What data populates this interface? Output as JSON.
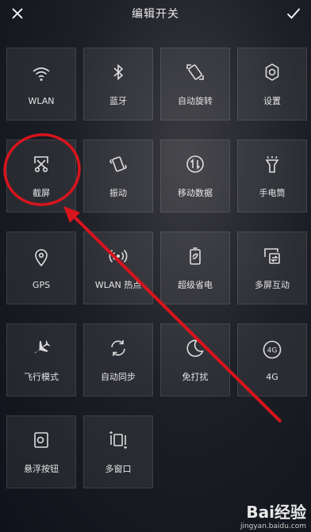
{
  "header": {
    "title": "编辑开关",
    "close_icon": "close-icon",
    "confirm_icon": "check-icon"
  },
  "tiles": [
    {
      "label": "WLAN",
      "icon": "wifi-icon"
    },
    {
      "label": "蓝牙",
      "icon": "bluetooth-icon"
    },
    {
      "label": "自动旋转",
      "icon": "rotate-icon"
    },
    {
      "label": "设置",
      "icon": "gear-icon"
    },
    {
      "label": "截屏",
      "icon": "screenshot-icon"
    },
    {
      "label": "振动",
      "icon": "vibrate-icon"
    },
    {
      "label": "移动数据",
      "icon": "mobile-data-icon"
    },
    {
      "label": "手电筒",
      "icon": "flashlight-icon"
    },
    {
      "label": "GPS",
      "icon": "location-icon"
    },
    {
      "label": "WLAN 热点",
      "icon": "hotspot-icon"
    },
    {
      "label": "超级省电",
      "icon": "battery-saver-icon"
    },
    {
      "label": "多屏互动",
      "icon": "multiscreen-icon"
    },
    {
      "label": "飞行模式",
      "icon": "airplane-icon"
    },
    {
      "label": "自动同步",
      "icon": "sync-icon"
    },
    {
      "label": "免打扰",
      "icon": "moon-icon"
    },
    {
      "label": "4G",
      "icon": "4g-icon"
    },
    {
      "label": "悬浮按钮",
      "icon": "floating-button-icon"
    },
    {
      "label": "多窗口",
      "icon": "multiwindow-icon"
    }
  ],
  "annotation": {
    "color": "#d8141c",
    "highlighted": "截屏"
  },
  "watermark": {
    "brand": "Bai经验",
    "url": "jingyan.baidu.com"
  }
}
